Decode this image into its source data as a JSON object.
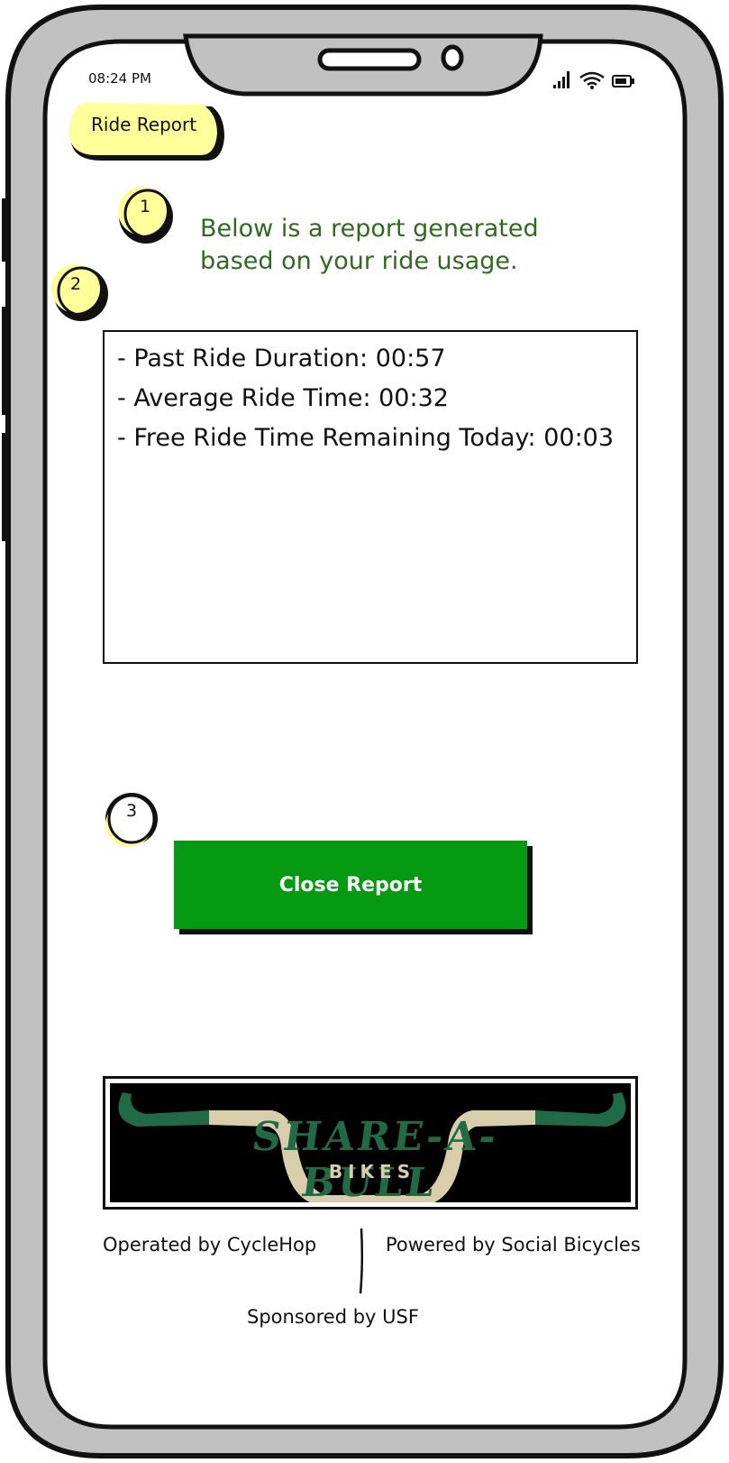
{
  "status_bar": {
    "time": "08:24 PM",
    "icons": [
      "signal-icon",
      "wifi-icon",
      "battery-icon"
    ]
  },
  "header": {
    "title": "Ride Report"
  },
  "callouts": [
    "1",
    "2",
    "3"
  ],
  "intro_text": "Below is a report generated based on your ride usage.",
  "report": {
    "items": [
      "- Past Ride Duration: 00:57",
      "- Average Ride Time: 00:32",
      "- Free Ride Time Remaining Today: 00:03"
    ]
  },
  "close_button": {
    "label": "Close Report",
    "color": "#069a13"
  },
  "banner": {
    "brand": "SHARE-A-BULL",
    "sub": "BIKES"
  },
  "footer": {
    "operated_by": "Operated by CycleHop",
    "powered_by": "Powered by Social Bicycles",
    "sponsored_by": "Sponsored by USF"
  },
  "colors": {
    "highlight": "#ffff99",
    "intro_text": "#2f6a1e",
    "frame_gray": "#c1c1c1",
    "brand_green": "#1e6b45",
    "brand_tan": "#d9ceaa"
  }
}
